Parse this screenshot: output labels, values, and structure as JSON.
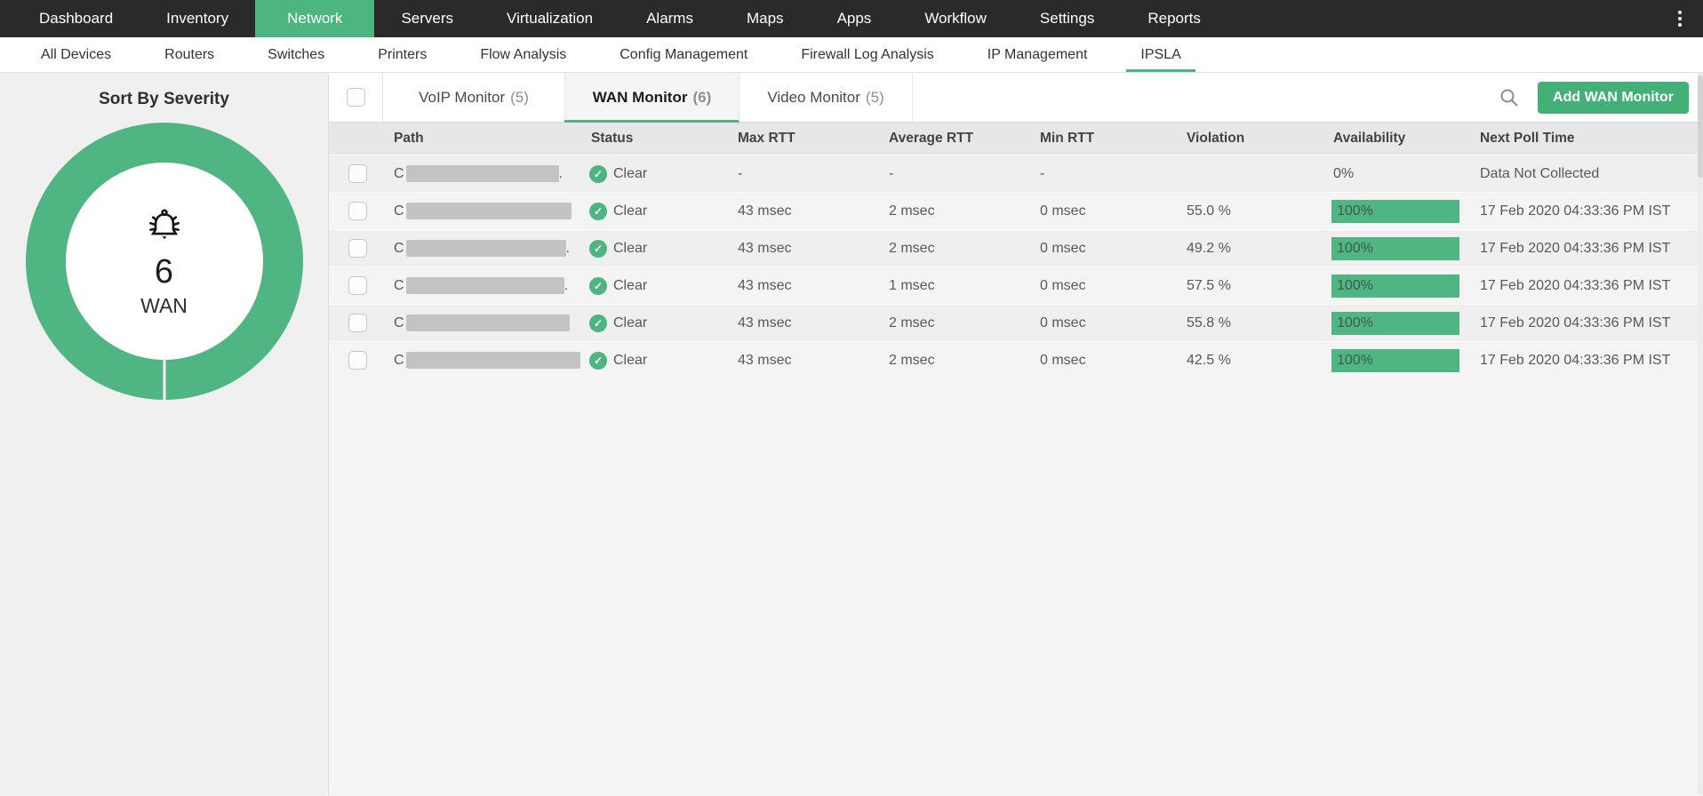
{
  "colors": {
    "accent_green": "#4db680",
    "button_green": "#43b077",
    "bar_green": "#4fb583",
    "nav_bg": "#2a2a2a"
  },
  "icons": {
    "check": "✓",
    "menu": "kebab-menu",
    "search": "magnifier",
    "severity": "alarm-bell"
  },
  "topnav": {
    "items": [
      {
        "label": "Dashboard",
        "active": false
      },
      {
        "label": "Inventory",
        "active": false
      },
      {
        "label": "Network",
        "active": true
      },
      {
        "label": "Servers",
        "active": false
      },
      {
        "label": "Virtualization",
        "active": false
      },
      {
        "label": "Alarms",
        "active": false
      },
      {
        "label": "Maps",
        "active": false
      },
      {
        "label": "Apps",
        "active": false
      },
      {
        "label": "Workflow",
        "active": false
      },
      {
        "label": "Settings",
        "active": false
      },
      {
        "label": "Reports",
        "active": false
      }
    ]
  },
  "subnav": {
    "items": [
      {
        "label": "All Devices",
        "active": false
      },
      {
        "label": "Routers",
        "active": false
      },
      {
        "label": "Switches",
        "active": false
      },
      {
        "label": "Printers",
        "active": false
      },
      {
        "label": "Flow Analysis",
        "active": false
      },
      {
        "label": "Config Management",
        "active": false
      },
      {
        "label": "Firewall Log Analysis",
        "active": false
      },
      {
        "label": "IP Management",
        "active": false
      },
      {
        "label": "IPSLA",
        "active": true
      }
    ]
  },
  "sidebar": {
    "title": "Sort By Severity",
    "donut": {
      "count": "6",
      "label": "WAN"
    }
  },
  "toolbar": {
    "tabs": [
      {
        "label": "VoIP Monitor",
        "count": "(5)",
        "active": false
      },
      {
        "label": "WAN Monitor",
        "count": "(6)",
        "active": true
      },
      {
        "label": "Video Monitor",
        "count": "(5)",
        "active": false
      }
    ],
    "add_button": "Add WAN Monitor"
  },
  "table": {
    "headers": [
      "Path",
      "Status",
      "Max RTT",
      "Average RTT",
      "Min RTT",
      "Violation",
      "Availability",
      "Next Poll Time"
    ],
    "rows": [
      {
        "path_visible": "C",
        "redact_width": 172,
        "path_tail": ".",
        "status": "Clear",
        "max_rtt": "-",
        "avg_rtt": "-",
        "min_rtt": "-",
        "violation": "",
        "availability_bar": false,
        "availability": "0%",
        "next_poll": "Data Not Collected"
      },
      {
        "path_visible": "C",
        "redact_width": 186,
        "path_tail": "",
        "status": "Clear",
        "max_rtt": "43 msec",
        "avg_rtt": "2 msec",
        "min_rtt": "0 msec",
        "violation": "55.0 %",
        "availability_bar": true,
        "availability": "100%",
        "next_poll": "17 Feb 2020 04:33:36 PM IST"
      },
      {
        "path_visible": "C",
        "redact_width": 180,
        "path_tail": ".",
        "status": "Clear",
        "max_rtt": "43 msec",
        "avg_rtt": "2 msec",
        "min_rtt": "0 msec",
        "violation": "49.2 %",
        "availability_bar": true,
        "availability": "100%",
        "next_poll": "17 Feb 2020 04:33:36 PM IST"
      },
      {
        "path_visible": "C",
        "redact_width": 178,
        "path_tail": ".",
        "status": "Clear",
        "max_rtt": "43 msec",
        "avg_rtt": "1 msec",
        "min_rtt": "0 msec",
        "violation": "57.5 %",
        "availability_bar": true,
        "availability": "100%",
        "next_poll": "17 Feb 2020 04:33:36 PM IST"
      },
      {
        "path_visible": "C",
        "redact_width": 184,
        "path_tail": "",
        "status": "Clear",
        "max_rtt": "43 msec",
        "avg_rtt": "2 msec",
        "min_rtt": "0 msec",
        "violation": "55.8 %",
        "availability_bar": true,
        "availability": "100%",
        "next_poll": "17 Feb 2020 04:33:36 PM IST"
      },
      {
        "path_visible": "C",
        "redact_width": 196,
        "path_tail": "",
        "status": "Clear",
        "max_rtt": "43 msec",
        "avg_rtt": "2 msec",
        "min_rtt": "0 msec",
        "violation": "42.5 %",
        "availability_bar": true,
        "availability": "100%",
        "next_poll": "17 Feb 2020 04:33:36 PM IST"
      }
    ]
  }
}
